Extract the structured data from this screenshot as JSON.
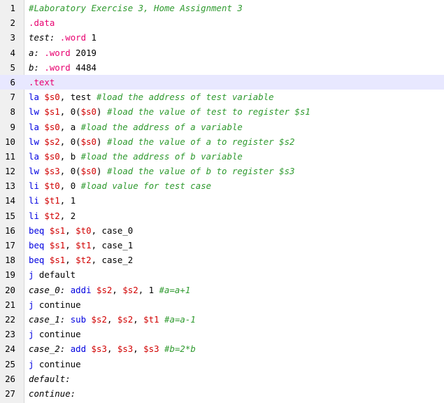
{
  "editor": {
    "highlight_color": "#e8e8ff",
    "current_line": 6,
    "lines": [
      {
        "num": "1",
        "segs": [
          {
            "t": "#Laboratory Exercise 3, Home Assignment 3",
            "c": "cm"
          }
        ]
      },
      {
        "num": "2",
        "segs": [
          {
            "t": ".data",
            "c": "dr"
          }
        ]
      },
      {
        "num": "3",
        "segs": [
          {
            "t": "test:",
            "c": "lbl"
          },
          {
            "t": " ",
            "c": ""
          },
          {
            "t": ".word",
            "c": "dr"
          },
          {
            "t": " 1",
            "c": ""
          }
        ]
      },
      {
        "num": "4",
        "segs": [
          {
            "t": "a:",
            "c": "lbl"
          },
          {
            "t": " ",
            "c": ""
          },
          {
            "t": ".word",
            "c": "dr"
          },
          {
            "t": " 2019",
            "c": ""
          }
        ]
      },
      {
        "num": "5",
        "segs": [
          {
            "t": "b:",
            "c": "lbl"
          },
          {
            "t": " ",
            "c": ""
          },
          {
            "t": ".word",
            "c": "dr"
          },
          {
            "t": " 4484",
            "c": ""
          }
        ]
      },
      {
        "num": "6",
        "segs": [
          {
            "t": ".text",
            "c": "dr"
          }
        ]
      },
      {
        "num": "7",
        "segs": [
          {
            "t": "la",
            "c": "ins"
          },
          {
            "t": " ",
            "c": ""
          },
          {
            "t": "$s0",
            "c": "reg"
          },
          {
            "t": ", test ",
            "c": ""
          },
          {
            "t": "#load the address of test variable",
            "c": "cm"
          }
        ]
      },
      {
        "num": "8",
        "segs": [
          {
            "t": "lw",
            "c": "ins"
          },
          {
            "t": " ",
            "c": ""
          },
          {
            "t": "$s1",
            "c": "reg"
          },
          {
            "t": ", 0(",
            "c": ""
          },
          {
            "t": "$s0",
            "c": "reg"
          },
          {
            "t": ") ",
            "c": ""
          },
          {
            "t": "#load the value of test to register $s1",
            "c": "cm"
          }
        ]
      },
      {
        "num": "9",
        "segs": [
          {
            "t": "la",
            "c": "ins"
          },
          {
            "t": " ",
            "c": ""
          },
          {
            "t": "$s0",
            "c": "reg"
          },
          {
            "t": ", a ",
            "c": ""
          },
          {
            "t": "#load the address of a variable",
            "c": "cm"
          }
        ]
      },
      {
        "num": "10",
        "segs": [
          {
            "t": "lw",
            "c": "ins"
          },
          {
            "t": " ",
            "c": ""
          },
          {
            "t": "$s2",
            "c": "reg"
          },
          {
            "t": ", 0(",
            "c": ""
          },
          {
            "t": "$s0",
            "c": "reg"
          },
          {
            "t": ") ",
            "c": ""
          },
          {
            "t": "#load the value of a to register $s2",
            "c": "cm"
          }
        ]
      },
      {
        "num": "11",
        "segs": [
          {
            "t": "la",
            "c": "ins"
          },
          {
            "t": " ",
            "c": ""
          },
          {
            "t": "$s0",
            "c": "reg"
          },
          {
            "t": ", b ",
            "c": ""
          },
          {
            "t": "#load the address of b variable",
            "c": "cm"
          }
        ]
      },
      {
        "num": "12",
        "segs": [
          {
            "t": "lw",
            "c": "ins"
          },
          {
            "t": " ",
            "c": ""
          },
          {
            "t": "$s3",
            "c": "reg"
          },
          {
            "t": ", 0(",
            "c": ""
          },
          {
            "t": "$s0",
            "c": "reg"
          },
          {
            "t": ") ",
            "c": ""
          },
          {
            "t": "#load the value of b to register $s3",
            "c": "cm"
          }
        ]
      },
      {
        "num": "13",
        "segs": [
          {
            "t": "li",
            "c": "ins"
          },
          {
            "t": " ",
            "c": ""
          },
          {
            "t": "$t0",
            "c": "reg"
          },
          {
            "t": ", 0 ",
            "c": ""
          },
          {
            "t": "#load value for test case",
            "c": "cm"
          }
        ]
      },
      {
        "num": "14",
        "segs": [
          {
            "t": "li",
            "c": "ins"
          },
          {
            "t": " ",
            "c": ""
          },
          {
            "t": "$t1",
            "c": "reg"
          },
          {
            "t": ", 1",
            "c": ""
          }
        ]
      },
      {
        "num": "15",
        "segs": [
          {
            "t": "li",
            "c": "ins"
          },
          {
            "t": " ",
            "c": ""
          },
          {
            "t": "$t2",
            "c": "reg"
          },
          {
            "t": ", 2",
            "c": ""
          }
        ]
      },
      {
        "num": "16",
        "segs": [
          {
            "t": "beq",
            "c": "ins"
          },
          {
            "t": " ",
            "c": ""
          },
          {
            "t": "$s1",
            "c": "reg"
          },
          {
            "t": ", ",
            "c": ""
          },
          {
            "t": "$t0",
            "c": "reg"
          },
          {
            "t": ", case_0",
            "c": ""
          }
        ]
      },
      {
        "num": "17",
        "segs": [
          {
            "t": "beq",
            "c": "ins"
          },
          {
            "t": " ",
            "c": ""
          },
          {
            "t": "$s1",
            "c": "reg"
          },
          {
            "t": ", ",
            "c": ""
          },
          {
            "t": "$t1",
            "c": "reg"
          },
          {
            "t": ", case_1",
            "c": ""
          }
        ]
      },
      {
        "num": "18",
        "segs": [
          {
            "t": "beq",
            "c": "ins"
          },
          {
            "t": " ",
            "c": ""
          },
          {
            "t": "$s1",
            "c": "reg"
          },
          {
            "t": ", ",
            "c": ""
          },
          {
            "t": "$t2",
            "c": "reg"
          },
          {
            "t": ", case_2",
            "c": ""
          }
        ]
      },
      {
        "num": "19",
        "segs": [
          {
            "t": "j",
            "c": "ins"
          },
          {
            "t": " default",
            "c": ""
          }
        ]
      },
      {
        "num": "20",
        "segs": [
          {
            "t": "case_0:",
            "c": "lbl"
          },
          {
            "t": " ",
            "c": ""
          },
          {
            "t": "addi",
            "c": "ins"
          },
          {
            "t": " ",
            "c": ""
          },
          {
            "t": "$s2",
            "c": "reg"
          },
          {
            "t": ", ",
            "c": ""
          },
          {
            "t": "$s2",
            "c": "reg"
          },
          {
            "t": ", 1 ",
            "c": ""
          },
          {
            "t": "#a=a+1",
            "c": "cm"
          }
        ]
      },
      {
        "num": "21",
        "segs": [
          {
            "t": "j",
            "c": "ins"
          },
          {
            "t": " continue",
            "c": ""
          }
        ]
      },
      {
        "num": "22",
        "segs": [
          {
            "t": "case_1:",
            "c": "lbl"
          },
          {
            "t": " ",
            "c": ""
          },
          {
            "t": "sub",
            "c": "ins"
          },
          {
            "t": " ",
            "c": ""
          },
          {
            "t": "$s2",
            "c": "reg"
          },
          {
            "t": ", ",
            "c": ""
          },
          {
            "t": "$s2",
            "c": "reg"
          },
          {
            "t": ", ",
            "c": ""
          },
          {
            "t": "$t1",
            "c": "reg"
          },
          {
            "t": " ",
            "c": ""
          },
          {
            "t": "#a=a-1",
            "c": "cm"
          }
        ]
      },
      {
        "num": "23",
        "segs": [
          {
            "t": "j",
            "c": "ins"
          },
          {
            "t": " continue",
            "c": ""
          }
        ]
      },
      {
        "num": "24",
        "segs": [
          {
            "t": "case_2:",
            "c": "lbl"
          },
          {
            "t": " ",
            "c": ""
          },
          {
            "t": "add",
            "c": "ins"
          },
          {
            "t": " ",
            "c": ""
          },
          {
            "t": "$s3",
            "c": "reg"
          },
          {
            "t": ", ",
            "c": ""
          },
          {
            "t": "$s3",
            "c": "reg"
          },
          {
            "t": ", ",
            "c": ""
          },
          {
            "t": "$s3",
            "c": "reg"
          },
          {
            "t": " ",
            "c": ""
          },
          {
            "t": "#b=2*b",
            "c": "cm"
          }
        ]
      },
      {
        "num": "25",
        "segs": [
          {
            "t": "j",
            "c": "ins"
          },
          {
            "t": " continue",
            "c": ""
          }
        ]
      },
      {
        "num": "26",
        "segs": [
          {
            "t": "default:",
            "c": "lbl"
          }
        ]
      },
      {
        "num": "27",
        "segs": [
          {
            "t": "continue:",
            "c": "lbl"
          }
        ]
      }
    ]
  }
}
